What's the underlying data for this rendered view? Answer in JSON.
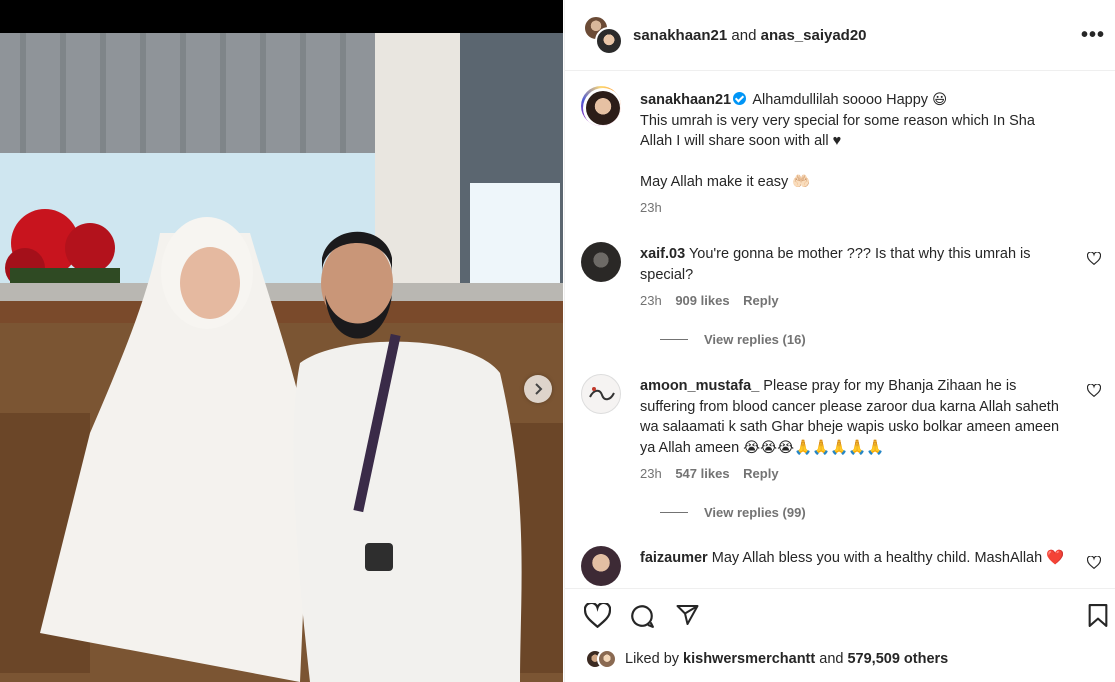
{
  "header": {
    "user1": "sanakhaan21",
    "and": "and",
    "user2": "anas_saiyad20",
    "more_label": "•••"
  },
  "caption": {
    "username": "sanakhaan21",
    "line1": "Alhamdullilah soooo Happy 😃",
    "line2": "This umrah is very very special for some reason which In Sha Allah I will share soon with all ♥",
    "line3": "May Allah make it easy 🤲🏻",
    "time": "23h"
  },
  "comments": [
    {
      "username": "xaif.03",
      "text": "You're gonna be mother ??? Is that why this umrah is special?",
      "time": "23h",
      "likes": "909 likes",
      "reply": "Reply",
      "view_replies": "View replies (16)"
    },
    {
      "username": "amoon_mustafa_",
      "text": "Please pray for my Bhanja Zihaan he is suffering from blood cancer please zaroor dua karna Allah saheth wa salaamati k sath Ghar bheje wapis usko bolkar ameen ameen ya Allah ameen 😭😭😭🙏🙏🙏🙏🙏",
      "time": "23h",
      "likes": "547 likes",
      "reply": "Reply",
      "view_replies": "View replies (99)"
    },
    {
      "username": "faizaumer",
      "text": "May Allah bless you with a healthy child. MashAllah ❤️"
    }
  ],
  "likes": {
    "prefix": "Liked by",
    "user": "kishwersmerchantt",
    "and": "and",
    "count": "579,509 others"
  },
  "icons": {
    "like": "heart-icon",
    "comment": "comment-icon",
    "share": "share-icon",
    "save": "bookmark-icon",
    "next": "chevron-right-icon"
  },
  "colors": {
    "verified": "#0095f6",
    "secondary_text": "#737373",
    "border": "#efefef"
  }
}
